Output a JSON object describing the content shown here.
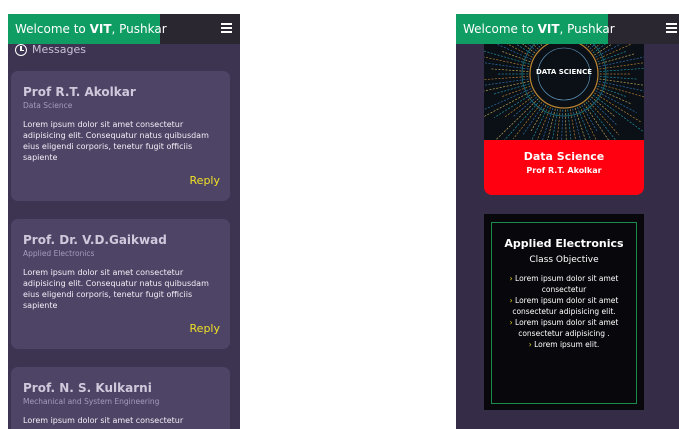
{
  "left_screen": {
    "header": {
      "welcome_prefix": "Welcome to ",
      "welcome_bold": "VIT",
      "welcome_suffix": ", Pushkar"
    },
    "messages_label": "Messages",
    "messages": [
      {
        "name": "Prof R.T. Akolkar",
        "subject": "Data Science",
        "body": "Lorem ipsum dolor sit amet consectetur adipisicing elit. Consequatur natus quibusdam eius eligendi corporis, tenetur fugit officiis sapiente",
        "reply": "Reply"
      },
      {
        "name": "Prof. Dr. V.D.Gaikwad",
        "subject": "Applied Electronics",
        "body": "Lorem ipsum dolor sit amet consectetur adipisicing elit. Consequatur natus quibusdam eius eligendi corporis, tenetur fugit officiis sapiente",
        "reply": "Reply"
      },
      {
        "name": "Prof. N. S. Kulkarni",
        "subject": "Mechanical and System Engineering",
        "body": "Lorem ipsum dolor sit amet consectetur",
        "reply": ""
      }
    ]
  },
  "right_screen": {
    "header": {
      "welcome_prefix": "Welcome to ",
      "welcome_bold": "VIT",
      "welcome_suffix": ", Pushkar"
    },
    "course_card": {
      "image_text": "DATA SCIENCE",
      "title": "Data Science",
      "professor": "Prof R.T. Akolkar"
    },
    "objective_card": {
      "title": "Applied Electronics",
      "subtitle": "Class Objective",
      "items": [
        "Lorem ipsum dolor sit amet consectetur",
        "Lorem ipsum dolor sit amet consectetur adipisicing elit.",
        "Lorem ipsum dolor sit amet consectetur adipisicing .",
        "Lorem ipsum elit."
      ]
    }
  },
  "colors": {
    "header_green": "#0f9d64",
    "accent_red": "#ff0010",
    "reply_yellow": "#f0e126",
    "panel_purple": "#3d3452"
  }
}
